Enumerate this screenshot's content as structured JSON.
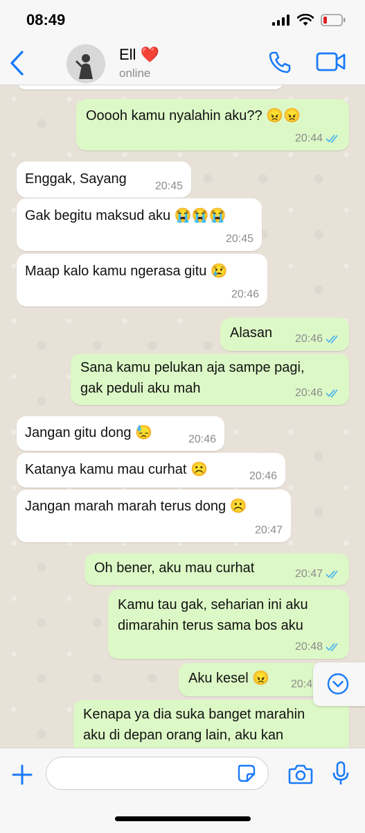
{
  "status_bar": {
    "time": "08:49"
  },
  "header": {
    "contact_name": "Ell ❤️",
    "contact_status": "online"
  },
  "messages": [
    {
      "dir": "out",
      "text": "Ooooh kamu nyalahin aku?? 😠😠",
      "time": "20:44",
      "read": true
    },
    {
      "dir": "in",
      "text": "Enggak, Sayang",
      "time": "20:45"
    },
    {
      "dir": "in",
      "text": "Gak begitu maksud aku 😭😭😭",
      "time": "20:45"
    },
    {
      "dir": "in",
      "text": "Maap kalo kamu ngerasa gitu 😢",
      "time": "20:46"
    },
    {
      "dir": "out",
      "text": "Alasan",
      "time": "20:46",
      "read": true
    },
    {
      "dir": "out",
      "text": "Sana kamu pelukan aja sampe pagi,\ngak peduli aku mah",
      "time": "20:46",
      "read": true
    },
    {
      "dir": "in",
      "text": "Jangan gitu dong 😓",
      "time": "20:46"
    },
    {
      "dir": "in",
      "text": "Katanya kamu mau curhat ☹️",
      "time": "20:46"
    },
    {
      "dir": "in",
      "text": "Jangan marah marah terus dong ☹️",
      "time": "20:47"
    },
    {
      "dir": "out",
      "text": "Oh bener, aku mau curhat",
      "time": "20:47",
      "read": true
    },
    {
      "dir": "out",
      "text": "Kamu tau gak, seharian ini aku\ndimarahin terus sama bos aku",
      "time": "20:48",
      "read": true
    },
    {
      "dir": "out",
      "text": "Aku kesel 😠",
      "time": "20:4",
      "read": true
    },
    {
      "dir": "out",
      "text": "Kenapa ya dia suka banget marahin\naku di depan orang lain, aku kan\nmalu",
      "time": "",
      "read": false
    }
  ],
  "composer": {
    "value": "",
    "placeholder": ""
  },
  "icons": {
    "back": "chevron-left-icon",
    "call": "phone-icon",
    "video": "video-icon",
    "plus": "plus-icon",
    "sticker": "sticker-icon",
    "camera": "camera-icon",
    "mic": "microphone-icon",
    "scroll": "chevron-down-icon"
  },
  "colors": {
    "accent": "#1a7af8",
    "outgoing": "#dcf8c6",
    "incoming": "#ffffff",
    "read_ticks": "#4fb6ec"
  }
}
